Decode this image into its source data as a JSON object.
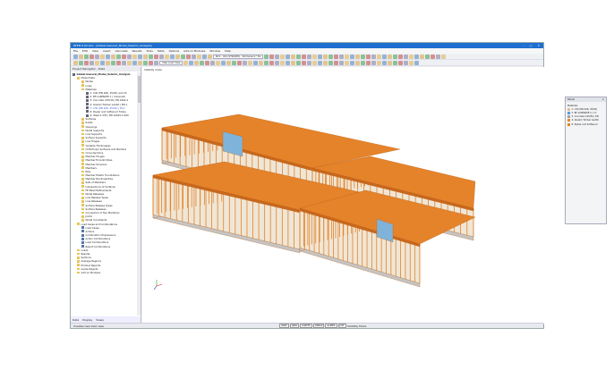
{
  "window": {
    "title": "RFEM 6.02.0xx - [Global-General_Model_Seismic_Analysis]"
  },
  "menu": [
    "File",
    "Edit",
    "View",
    "Insert",
    "Calculate",
    "Results",
    "Tools",
    "Table",
    "Options",
    "Add-on Modules",
    "Window",
    "Help"
  ],
  "toolbar": {
    "load_case": "RC1 - ULS (STR/GEO) - Permanent / Tra",
    "view_load_case": "View Load Case"
  },
  "navigator": {
    "title": "Project Navigator - Data",
    "items": [
      {
        "label": "Global-General_Model_Seismic_Analysis",
        "level": 0,
        "type": "model"
      },
      {
        "label": "Model Data",
        "level": 1,
        "type": "folder"
      },
      {
        "label": "Nodes",
        "level": 2,
        "type": "folder"
      },
      {
        "label": "Lines",
        "level": 2,
        "type": "folder"
      },
      {
        "label": "Materials",
        "level": 2,
        "type": "folder"
      },
      {
        "label": "1: C30 (EN 206, 35/45) and C5",
        "level": 3,
        "type": "mat"
      },
      {
        "label": "2: BF-LAMINATE 1 | Composit",
        "level": 3,
        "type": "mat"
      },
      {
        "label": "3: Concrete C25/30 | EN 1992-1",
        "level": 3,
        "type": "mat"
      },
      {
        "label": "4: Glulam Timber GL24h | EN 1",
        "level": 3,
        "type": "mat"
      },
      {
        "label": "7: C30 (EN 206, 35/45) | Prec",
        "level": 3,
        "type": "mat",
        "highlight": true
      },
      {
        "label": "8: Poplar and Softwood Timbe",
        "level": 3,
        "type": "mat"
      },
      {
        "label": "9: Steel S 235 | EN 10025-2:200",
        "level": 3,
        "type": "mat"
      },
      {
        "label": "Surfaces",
        "level": 2,
        "type": "folder"
      },
      {
        "label": "Solids",
        "level": 2,
        "type": "folder"
      },
      {
        "label": "Openings",
        "level": 2,
        "type": "folder"
      },
      {
        "label": "Nodal Supports",
        "level": 2,
        "type": "folder"
      },
      {
        "label": "Line Supports",
        "level": 2,
        "type": "folder"
      },
      {
        "label": "Surface Supports",
        "level": 2,
        "type": "folder"
      },
      {
        "label": "Line Hinges",
        "level": 2,
        "type": "folder"
      },
      {
        "label": "Variable Thicknesses",
        "level": 2,
        "type": "folder"
      },
      {
        "label": "Orthotropic Surfaces and Membra",
        "level": 2,
        "type": "folder"
      },
      {
        "label": "Cross-Sections",
        "level": 2,
        "type": "folder"
      },
      {
        "label": "Member Hinges",
        "level": 2,
        "type": "folder"
      },
      {
        "label": "Member Eccentricities",
        "level": 2,
        "type": "folder"
      },
      {
        "label": "Member Divisions",
        "level": 2,
        "type": "folder"
      },
      {
        "label": "Members",
        "level": 2,
        "type": "folder"
      },
      {
        "label": "Ribs",
        "level": 2,
        "type": "folder"
      },
      {
        "label": "Member Elastic Foundations",
        "level": 2,
        "type": "folder"
      },
      {
        "label": "Member Nonlinearities",
        "level": 2,
        "type": "folder"
      },
      {
        "label": "Sets of Members",
        "level": 2,
        "type": "folder"
      },
      {
        "label": "Intersections of Surfaces",
        "level": 2,
        "type": "folder"
      },
      {
        "label": "FE Mesh Refinements",
        "level": 2,
        "type": "folder"
      },
      {
        "label": "Nodal Releases",
        "level": 2,
        "type": "folder"
      },
      {
        "label": "Line Release Types",
        "level": 2,
        "type": "folder"
      },
      {
        "label": "Line Releases",
        "level": 2,
        "type": "folder"
      },
      {
        "label": "Surface Release Types",
        "level": 2,
        "type": "folder"
      },
      {
        "label": "Surface Releases",
        "level": 2,
        "type": "folder"
      },
      {
        "label": "Connection of Two Members",
        "level": 2,
        "type": "folder"
      },
      {
        "label": "Joints",
        "level": 2,
        "type": "folder"
      },
      {
        "label": "Nodal Constraints",
        "level": 2,
        "type": "folder"
      },
      {
        "label": "Load Cases and Combinations",
        "level": 1,
        "type": "folder"
      },
      {
        "label": "Load Cases",
        "level": 2,
        "type": "lc"
      },
      {
        "label": "Actions",
        "level": 2,
        "type": "lc"
      },
      {
        "label": "Combination Expressions",
        "level": 2,
        "type": "lc"
      },
      {
        "label": "Action Combinations",
        "level": 2,
        "type": "lc"
      },
      {
        "label": "Load Combinations",
        "level": 2,
        "type": "lc"
      },
      {
        "label": "Result Combinations",
        "level": 2,
        "type": "lc"
      },
      {
        "label": "Loads",
        "level": 1,
        "type": "folder"
      },
      {
        "label": "Results",
        "level": 1,
        "type": "folder"
      },
      {
        "label": "Sections",
        "level": 1,
        "type": "folder"
      },
      {
        "label": "Average Regions",
        "level": 1,
        "type": "folder"
      },
      {
        "label": "Printout Reports",
        "level": 1,
        "type": "folder"
      },
      {
        "label": "Guide Objects",
        "level": 1,
        "type": "folder"
      },
      {
        "label": "Add-on Modules",
        "level": 1,
        "type": "folder"
      }
    ],
    "tabs": [
      "Data",
      "Display",
      "Views"
    ]
  },
  "viewport": {
    "label": "Visibility mode"
  },
  "panel": {
    "title": "Panel",
    "section": "Materials",
    "items": [
      {
        "label": "1: C30 (EN 206, 35/45)",
        "color": "#e8b98c"
      },
      {
        "label": "2: BF-LAMINATE 1 | Co",
        "color": "#5b9bd5"
      },
      {
        "label": "3: Concrete C25/30 | EN",
        "color": "#a0a0a0"
      },
      {
        "label": "4: Glulam Timber GL24h",
        "color": "#e48a2a"
      },
      {
        "label": "8: Poplar and Softwood",
        "color": "#d98a1f"
      }
    ]
  },
  "status": {
    "text": "Creates new load case",
    "buttons": [
      "SNAP",
      "GRID",
      "CARTES",
      "OSNAP",
      "GLINES",
      "DXF"
    ],
    "mode": "Visibility Mode"
  },
  "colors": {
    "timber": "#e5832a",
    "concrete": "#c4c4c4",
    "glass": "#7fb3d9",
    "title_bar": "#1e6fd0"
  }
}
